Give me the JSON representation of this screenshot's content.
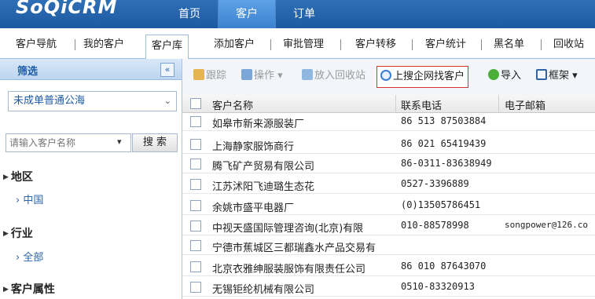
{
  "app": {
    "logo": "SoQiCRM"
  },
  "topnav": {
    "items": [
      "首页",
      "客户",
      "订单"
    ],
    "active": 1
  },
  "tabs": {
    "items": [
      "客户导航",
      "我的客户",
      "客户库",
      "添加客户",
      "审批管理",
      "客户转移",
      "客户统计",
      "黑名单",
      "回收站"
    ],
    "active": 2
  },
  "sidebar": {
    "title": "筛选",
    "collapse_icon": "«",
    "filter_select": "未成单普通公海",
    "search": {
      "placeholder": "请输入客户名称",
      "button": "搜 索"
    },
    "groups": [
      {
        "title": "地区",
        "item": "› 中国"
      },
      {
        "title": "行业",
        "item": "› 全部"
      },
      {
        "title": "客户属性",
        "item": ""
      }
    ]
  },
  "toolbar": {
    "track": "跟踪",
    "operate": "操作 ▾",
    "recycle": "放入回收站",
    "search_enterprise": "上搜企网找客户",
    "import": "导入",
    "frame": "框架 ▾"
  },
  "table": {
    "columns": [
      "客户名称",
      "联系电话",
      "电子邮箱"
    ],
    "rows": [
      {
        "name": "如皋市新来源服装厂",
        "phone": "86 513 87503884",
        "email": ""
      },
      {
        "name": "上海静家服饰商行",
        "phone": "86 021 65419439",
        "email": ""
      },
      {
        "name": "腾飞矿产贸易有限公司",
        "phone": "86-0311-83638949",
        "email": ""
      },
      {
        "name": "江苏沭阳飞迪璐生态花",
        "phone": "0527-3396889",
        "email": ""
      },
      {
        "name": "余姚市盛平电器厂",
        "phone": "(0)13505786451",
        "email": ""
      },
      {
        "name": "中视天盛国际管理咨询(北京)有限",
        "phone": "010-88578998",
        "email": "songpower@126.co"
      },
      {
        "name": "宁德市蕉城区三都瑞鑫水产品交易有",
        "phone": "",
        "email": ""
      },
      {
        "name": "北京衣雅绅服装服饰有限责任公司",
        "phone": "86 010 87643070",
        "email": ""
      },
      {
        "name": "无锡钜纶机械有限公司",
        "phone": "0510-83320913",
        "email": ""
      }
    ]
  },
  "colors": {
    "header": "#1c5aa0",
    "accent": "#2d64a8",
    "highlight_border": "#d9342b"
  }
}
